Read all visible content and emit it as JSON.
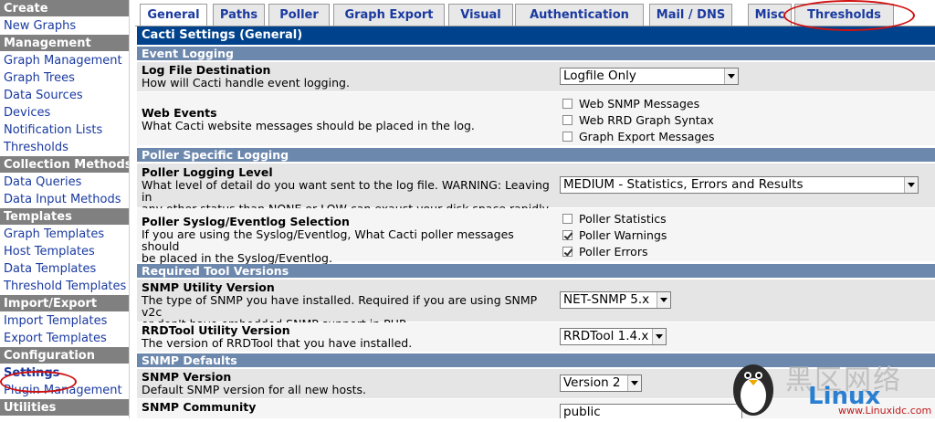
{
  "sidebar": {
    "items": [
      {
        "label": "Create",
        "type": "head"
      },
      {
        "label": "New Graphs",
        "type": "item"
      },
      {
        "label": "Management",
        "type": "head"
      },
      {
        "label": "Graph Management",
        "type": "item"
      },
      {
        "label": "Graph Trees",
        "type": "item"
      },
      {
        "label": "Data Sources",
        "type": "item"
      },
      {
        "label": "Devices",
        "type": "item"
      },
      {
        "label": "Notification Lists",
        "type": "item"
      },
      {
        "label": "Thresholds",
        "type": "item"
      },
      {
        "label": "Collection Methods",
        "type": "head"
      },
      {
        "label": "Data Queries",
        "type": "item"
      },
      {
        "label": "Data Input Methods",
        "type": "item"
      },
      {
        "label": "Templates",
        "type": "head"
      },
      {
        "label": "Graph Templates",
        "type": "item"
      },
      {
        "label": "Host Templates",
        "type": "item"
      },
      {
        "label": "Data Templates",
        "type": "item"
      },
      {
        "label": "Threshold Templates",
        "type": "item"
      },
      {
        "label": "Import/Export",
        "type": "head"
      },
      {
        "label": "Import Templates",
        "type": "item"
      },
      {
        "label": "Export Templates",
        "type": "item"
      },
      {
        "label": "Configuration",
        "type": "head"
      },
      {
        "label": "Settings",
        "type": "item",
        "active": true
      },
      {
        "label": "Plugin Management",
        "type": "item"
      },
      {
        "label": "Utilities",
        "type": "head"
      }
    ]
  },
  "tabs": [
    {
      "label": "General",
      "active": true
    },
    {
      "label": "Paths"
    },
    {
      "label": "Poller"
    },
    {
      "label": "Graph Export"
    },
    {
      "label": "Visual"
    },
    {
      "label": "Authentication"
    },
    {
      "label": "Mail / DNS"
    },
    {
      "label": "Misc"
    },
    {
      "label": "Thresholds"
    }
  ],
  "page": {
    "title": "Cacti Settings (General)"
  },
  "sections": {
    "event_logging": "Event Logging",
    "poller_logging": "Poller Specific Logging",
    "tool_versions": "Required Tool Versions",
    "snmp_defaults": "SNMP Defaults"
  },
  "settings": {
    "log_dest": {
      "title": "Log File Destination",
      "desc": "How will Cacti handle event logging.",
      "value": "Logfile Only"
    },
    "web_events": {
      "title": "Web Events",
      "desc": "What Cacti website messages should be placed in the log.",
      "options": [
        {
          "label": "Web SNMP Messages",
          "checked": false
        },
        {
          "label": "Web RRD Graph Syntax",
          "checked": false
        },
        {
          "label": "Graph Export Messages",
          "checked": false
        }
      ]
    },
    "poller_level": {
      "title": "Poller Logging Level",
      "desc1": "What level of detail do you want sent to the log file. WARNING: Leaving in",
      "desc2": "any other status than NONE or LOW can exaust your disk space rapidly.",
      "value": "MEDIUM - Statistics, Errors and Results"
    },
    "poller_syslog": {
      "title": "Poller Syslog/Eventlog Selection",
      "desc1": "If you are using the Syslog/Eventlog, What Cacti poller messages should",
      "desc2": "be placed in the Syslog/Eventlog.",
      "options": [
        {
          "label": "Poller Statistics",
          "checked": false
        },
        {
          "label": "Poller Warnings",
          "checked": true
        },
        {
          "label": "Poller Errors",
          "checked": true
        }
      ]
    },
    "snmp_utility": {
      "title": "SNMP Utility Version",
      "desc1": "The type of SNMP you have installed. Required if you are using SNMP v2c",
      "desc2": "or don't have embedded SNMP support in PHP.",
      "value": "NET-SNMP 5.x"
    },
    "rrdtool_version": {
      "title": "RRDTool Utility Version",
      "desc": "The version of RRDTool that you have installed.",
      "value": "RRDTool 1.4.x"
    },
    "snmp_version": {
      "title": "SNMP Version",
      "desc": "Default SNMP version for all new hosts.",
      "value": "Version 2"
    },
    "snmp_community": {
      "title": "SNMP Community",
      "value": "public"
    }
  },
  "watermark": {
    "cn": "黑区网络",
    "latin": "Linux",
    "url": "www.Linuxidc.com"
  },
  "colors": {
    "title_bar": "#00438c",
    "section_bar": "#6d88ad",
    "link": "#1a3aa0",
    "highlight_circle": "#d01010"
  }
}
